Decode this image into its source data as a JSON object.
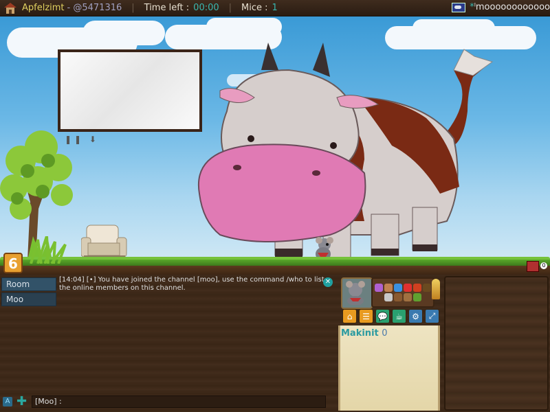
{
  "topbar": {
    "player_name": "Apfelzimt",
    "player_id": "- @5471316",
    "sep": "|",
    "time_label": "Time left :",
    "time_value": "00:00",
    "mice_label": "Mice :",
    "mice_value": "1",
    "room_prefix": "*",
    "room_name": "ˡmoooooooooooo"
  },
  "game": {
    "level": "6",
    "counter": "0"
  },
  "chat": {
    "channels": [
      {
        "label": "Room"
      },
      {
        "label": "Moo"
      }
    ],
    "messages": [
      {
        "text": "[14:04] [•] You have joined the channel [moo], use the command /who to list the online members on this channel."
      }
    ],
    "input_prefix": "[Moo] :",
    "a_icon": "A",
    "plus_icon": "✚"
  },
  "player_panel": {
    "name": "Makinit",
    "score": "0"
  },
  "toolbar": {
    "buttons": [
      "home-icon",
      "list-icon",
      "chat-icon",
      "tea-icon",
      "gear-icon",
      "fullscreen-icon"
    ]
  },
  "colors": {
    "accent": "#38b8b0",
    "name": "#e0d060",
    "wood": "#3f2a1a"
  }
}
